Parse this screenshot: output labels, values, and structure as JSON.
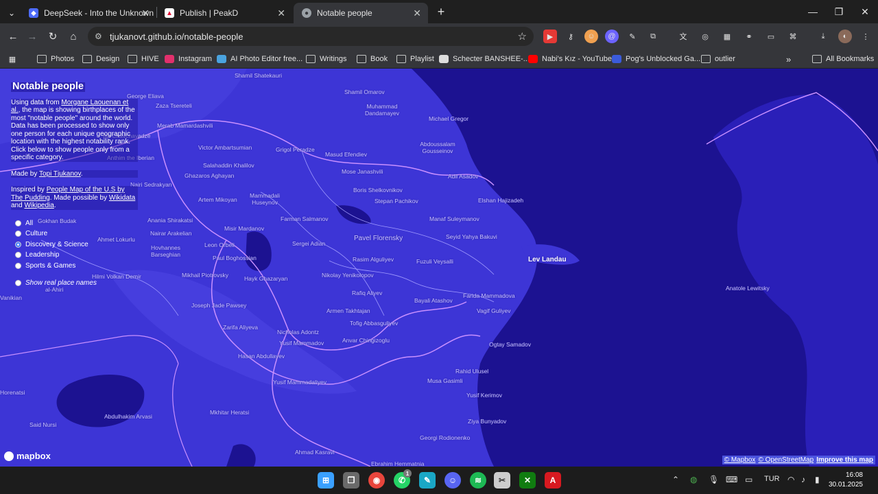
{
  "tabs": [
    {
      "title": "DeepSeek - Into the Unknown",
      "active": false
    },
    {
      "title": "Publish | PeakD",
      "active": false
    },
    {
      "title": "Notable people",
      "active": true
    }
  ],
  "window": {
    "minimize": "—",
    "maximize": "❐",
    "close": "✕",
    "new_tab": "+"
  },
  "address": {
    "url": "tjukanovt.github.io/notable-people"
  },
  "bookmarks": [
    {
      "label": "Photos"
    },
    {
      "label": "Design"
    },
    {
      "label": "HIVE"
    },
    {
      "label": "Instagram"
    },
    {
      "label": "AI Photo Editor free..."
    },
    {
      "label": "Writings"
    },
    {
      "label": "Book"
    },
    {
      "label": "Playlist"
    },
    {
      "label": "Schecter BANSHEE-..."
    },
    {
      "label": "Nabi's Kız - YouTube"
    },
    {
      "label": "Pog's Unblocked Ga..."
    },
    {
      "label": "outlier"
    }
  ],
  "bookmarks_more": "»",
  "all_bookmarks": "All Bookmarks",
  "panel": {
    "title": "Notable people",
    "intro_1": "Using data from ",
    "intro_link": "Morgane Laouenan et al.",
    "intro_2": ", the map is showing birthplaces of the most \"notable people\" around the world. Data has been processed to show only one person for each unique geographic location with the highest notability rank. Click below to show people only from a specific category.",
    "made_by_prefix": "Made by ",
    "made_by_link": "Topi Tjukanov",
    "made_by_suffix": ".",
    "inspired_prefix": "Inspired by ",
    "inspired_link": "People Map of the U.S by The Pudding",
    "inspired_mid": ". Made possible by ",
    "wikidata": "Wikidata",
    "and": " and ",
    "wikipedia": "Wikipedia",
    "end": ".",
    "options": [
      "All",
      "Culture",
      "Discovery & Science",
      "Leadership",
      "Sports & Games"
    ],
    "selected_option": "Discovery & Science",
    "toggle_label": "Show real place names"
  },
  "places": [
    {
      "name": "Shamil Shatekauri"
    },
    {
      "name": "George Eliava"
    },
    {
      "name": "Shamil Omarov"
    },
    {
      "name": "Zaza Tsereteli"
    },
    {
      "name": "Muhammad Dandamayev"
    },
    {
      "name": "Michael Gregor"
    },
    {
      "name": "Merab Mamardashvili"
    },
    {
      "name": "Ilia Chavchavadze"
    },
    {
      "name": "Abdoussalam Gousseinov"
    },
    {
      "name": "Victor Ambartsumian"
    },
    {
      "name": "Grigol Peradze"
    },
    {
      "name": "Masud Efendiev"
    },
    {
      "name": "Anthim the Iberian"
    },
    {
      "name": "Salahaddin Khalilov"
    },
    {
      "name": "Ghazaros Aghayan"
    },
    {
      "name": "Mose Janashvili"
    },
    {
      "name": "Adil Asadov"
    },
    {
      "name": "Nairi Sedrakyan"
    },
    {
      "name": "Boris Shelkovnikov"
    },
    {
      "name": "Elshan Hajizadeh"
    },
    {
      "name": "Artem Mikoyan"
    },
    {
      "name": "Mammadali Huseynov"
    },
    {
      "name": "Stepan Pachikov"
    },
    {
      "name": "Gokhan Budak"
    },
    {
      "name": "Anania Shirakatsi"
    },
    {
      "name": "Farman Salmanov"
    },
    {
      "name": "Manaf Suleymanov"
    },
    {
      "name": "Misir Mardanov"
    },
    {
      "name": "Nairar Arakelian"
    },
    {
      "name": "Ahmet Lokurlu"
    },
    {
      "name": "Pavel Florensky"
    },
    {
      "name": "Seyid Yahya Bakuvi"
    },
    {
      "name": "Sergei Adian"
    },
    {
      "name": "Leon Orbeli"
    },
    {
      "name": "Hovhannes Barseghian"
    },
    {
      "name": "Rasim Alguliyev"
    },
    {
      "name": "Paul Boghossian"
    },
    {
      "name": "Fuzuli Veysalli"
    },
    {
      "name": "Hilmi Volkan Demir"
    },
    {
      "name": "Mikhail Piotrovsky"
    },
    {
      "name": "Hayk Ghazaryan"
    },
    {
      "name": "Nikolay Yenikolopov"
    },
    {
      "name": "al-Ahiri"
    },
    {
      "name": "Rafiq Aliyev"
    },
    {
      "name": "Farida Mammadova"
    },
    {
      "name": "Anatole Lewitsky"
    },
    {
      "name": "Bayali Atashov"
    },
    {
      "name": "Joseph Jade Pawsey"
    },
    {
      "name": "Armen Takhtajan"
    },
    {
      "name": "Vagif Guliyev"
    },
    {
      "name": "Zarifa Aliyeva"
    },
    {
      "name": "Tofig Abbasguliyev"
    },
    {
      "name": "Nicholas Adontz"
    },
    {
      "name": "Yusif Mammadov"
    },
    {
      "name": "Anvar Chingizoglu"
    },
    {
      "name": "Ogtay Samadov"
    },
    {
      "name": "Hasan Abdullayev"
    },
    {
      "name": "Rahid Ulusel"
    },
    {
      "name": "Yusif Mammadaliyev"
    },
    {
      "name": "Musa Gasimli"
    },
    {
      "name": "Yusif Kerimov"
    },
    {
      "name": "Abdulhakim Arvasi"
    },
    {
      "name": "Mkhitar Heratsi"
    },
    {
      "name": "Said Nursi"
    },
    {
      "name": "Ziya Bunyadov"
    },
    {
      "name": "Heratsi"
    },
    {
      "name": "Georgi Rodionenko"
    },
    {
      "name": "Ahmad Kasravi"
    },
    {
      "name": "Ebrahim Hemmatnia"
    },
    {
      "name": "Vanikian"
    },
    {
      "name": "Horenatsi"
    },
    {
      "name": "Lev Landau"
    }
  ],
  "attribution": {
    "mapbox": "© Mapbox",
    "osm": "© OpenStreetMap",
    "improve": "Improve this map"
  },
  "mapbox_logo": "mapbox",
  "tray": {
    "language": "TUR",
    "time": "16:08",
    "date": "30.01.2025",
    "whatsapp_badge": "1"
  }
}
